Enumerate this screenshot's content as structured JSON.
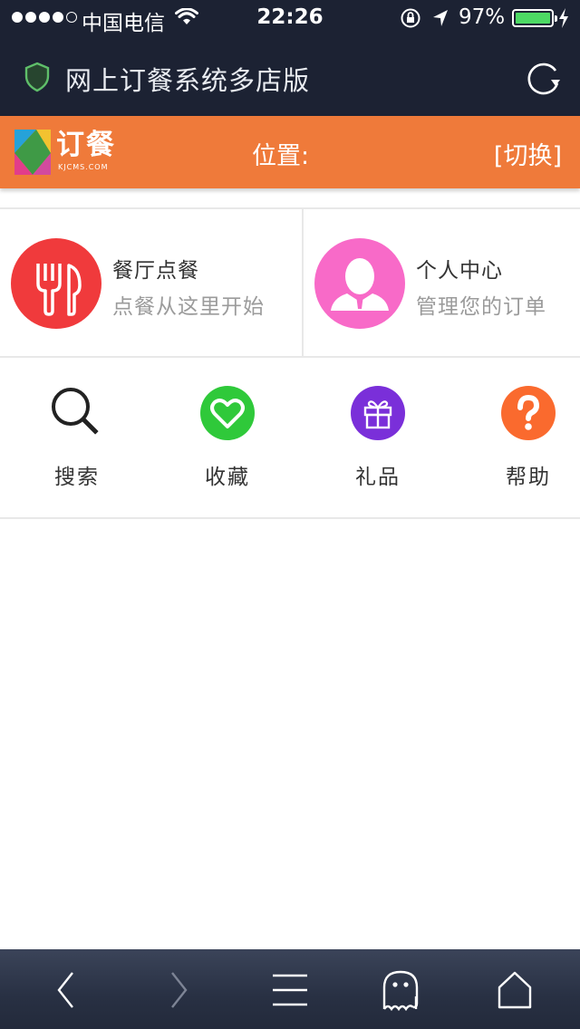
{
  "status_bar": {
    "carrier": "中国电信",
    "time": "22:26",
    "battery_percent": "97%",
    "battery_level": 0.97,
    "signal_bars_filled": 4,
    "signal_bars_total": 5
  },
  "browser": {
    "page_title": "网上订餐系统多店版"
  },
  "header": {
    "logo_text": "订餐",
    "logo_subtext": "KJCMS.COM",
    "location_label": "位置:",
    "switch_label": "[切换]"
  },
  "features": [
    {
      "title": "餐厅点餐",
      "subtitle": "点餐从这里开始",
      "icon": "fork-knife-icon",
      "color": "#f03a3c"
    },
    {
      "title": "个人中心",
      "subtitle": "管理您的订单",
      "icon": "user-icon",
      "color": "#f86ac8"
    }
  ],
  "shortcuts": [
    {
      "label": "搜索",
      "icon": "search-icon"
    },
    {
      "label": "收藏",
      "icon": "heart-icon",
      "color": "#2fc93a"
    },
    {
      "label": "礼品",
      "icon": "gift-icon",
      "color": "#7a2fd9"
    },
    {
      "label": "帮助",
      "icon": "question-icon",
      "color": "#fa6a2e"
    }
  ],
  "toolbar": {
    "items": [
      "back-icon",
      "forward-icon",
      "menu-icon",
      "ghost-icon",
      "home-icon"
    ]
  },
  "colors": {
    "chrome_dark": "#1c2233",
    "brand_orange": "#ef7a3a"
  }
}
